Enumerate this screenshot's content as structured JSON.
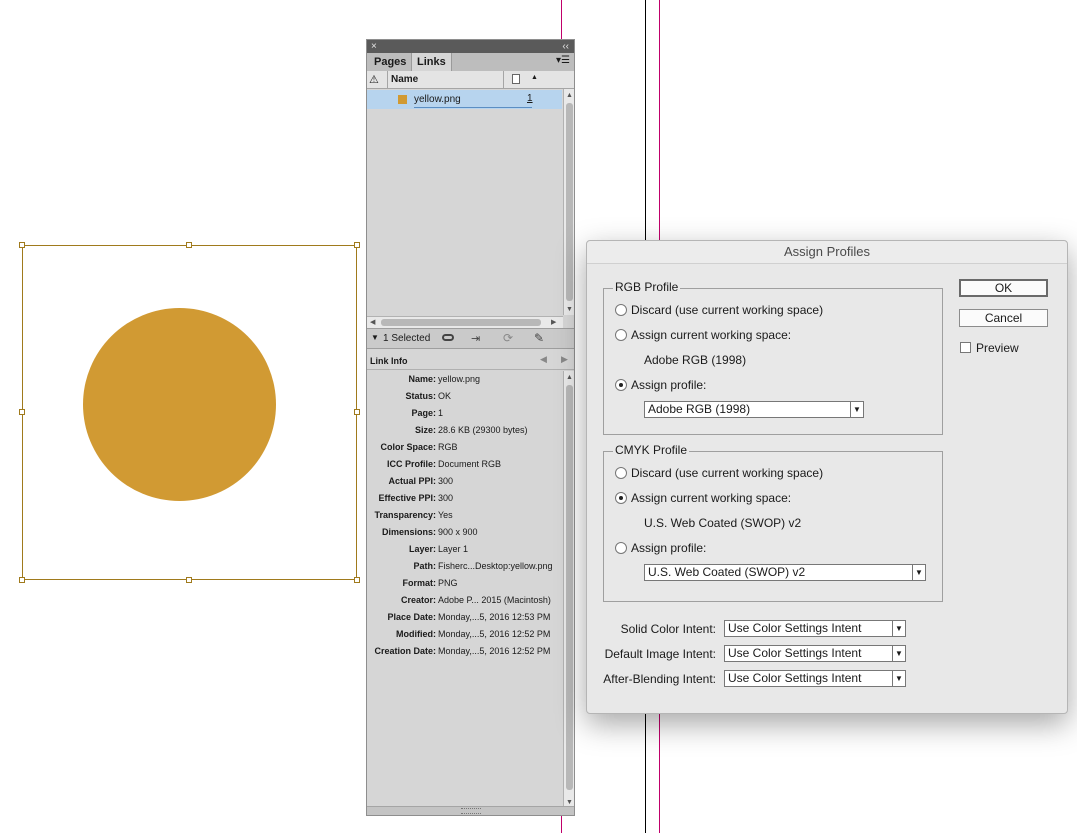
{
  "colors": {
    "circle": "#D19A33",
    "frame": "#A07A1C",
    "margin_guide": "#C0006A",
    "selection_row": "#B7D4EE"
  },
  "links_panel": {
    "close_glyph": "×",
    "collapse_glyph": "‹‹",
    "menu_glyph": "▾☰",
    "tabs": [
      "Pages",
      "Links"
    ],
    "active_tab": "Links",
    "header": {
      "warning_glyph": "⚠",
      "name_label": "Name",
      "page_glyph": "▲"
    },
    "items": [
      {
        "name": "yellow.png",
        "page": "1"
      }
    ],
    "status": {
      "selected_text": "1 Selected",
      "expand_glyph": "▼",
      "relink_icon": "chain-link-icon",
      "goto_icon": "go-to-link-icon",
      "update_icon": "update-link-icon",
      "edit_icon": "pencil-icon"
    },
    "link_info_title": "Link Info",
    "link_info": [
      {
        "key": "Name:",
        "value": "yellow.png"
      },
      {
        "key": "Status:",
        "value": "OK"
      },
      {
        "key": "Page:",
        "value": "1"
      },
      {
        "key": "Size:",
        "value": "28.6 KB (29300 bytes)"
      },
      {
        "key": "Color Space:",
        "value": "RGB"
      },
      {
        "key": "ICC Profile:",
        "value": "Document RGB"
      },
      {
        "key": "Actual PPI:",
        "value": "300"
      },
      {
        "key": "Effective PPI:",
        "value": "300"
      },
      {
        "key": "Transparency:",
        "value": "Yes"
      },
      {
        "key": "Dimensions:",
        "value": "900 x 900"
      },
      {
        "key": "Layer:",
        "value": "Layer 1"
      },
      {
        "key": "Path:",
        "value": "Fisherc...Desktop:yellow.png"
      },
      {
        "key": "Format:",
        "value": "PNG"
      },
      {
        "key": "Creator:",
        "value": "Adobe P... 2015 (Macintosh)"
      },
      {
        "key": "Place Date:",
        "value": "Monday,...5, 2016 12:53 PM"
      },
      {
        "key": "Modified:",
        "value": "Monday,...5, 2016 12:52 PM"
      },
      {
        "key": "Creation Date:",
        "value": "Monday,...5, 2016 12:52 PM"
      }
    ]
  },
  "dialog": {
    "title": "Assign Profiles",
    "rgb": {
      "group_title": "RGB Profile",
      "discard": "Discard (use current working space)",
      "assign_current": "Assign current working space:",
      "current_space": "Adobe RGB (1998)",
      "assign_profile": "Assign profile:",
      "profile_value": "Adobe RGB (1998)",
      "selected": "assign_profile"
    },
    "cmyk": {
      "group_title": "CMYK Profile",
      "discard": "Discard (use current working space)",
      "assign_current": "Assign current working space:",
      "current_space": "U.S. Web Coated (SWOP) v2",
      "assign_profile": "Assign profile:",
      "profile_value": "U.S. Web Coated (SWOP) v2",
      "selected": "assign_current"
    },
    "intents": [
      {
        "label": "Solid Color Intent:",
        "value": "Use Color Settings Intent"
      },
      {
        "label": "Default Image Intent:",
        "value": "Use Color Settings Intent"
      },
      {
        "label": "After-Blending Intent:",
        "value": "Use Color Settings Intent"
      }
    ],
    "buttons": {
      "ok": "OK",
      "cancel": "Cancel"
    },
    "preview_label": "Preview",
    "preview_checked": false
  }
}
